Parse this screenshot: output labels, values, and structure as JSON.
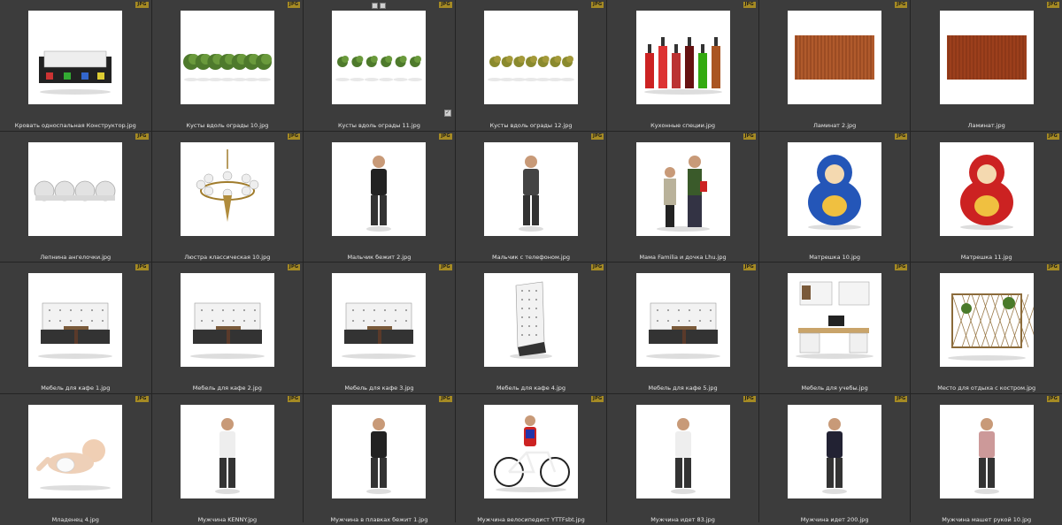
{
  "items": [
    {
      "caption": "Кровать односпальная Конструктор.jpg",
      "badge": "JPG",
      "icon": "bed-icon"
    },
    {
      "caption": "Кусты вдоль ограды 10.jpg",
      "badge": "JPG",
      "icon": "bushes-icon"
    },
    {
      "caption": "Кусты вдоль ограды 11.jpg",
      "badge": "JPG",
      "icon": "bushes-icon"
    },
    {
      "caption": "Кусты вдоль ограды 12.jpg",
      "badge": "JPG",
      "icon": "bushes-icon"
    },
    {
      "caption": "Кухонные специи.jpg",
      "badge": "JPG",
      "icon": "bottles-icon"
    },
    {
      "caption": "Ламинат 2.jpg",
      "badge": "JPG",
      "icon": "laminate-icon"
    },
    {
      "caption": "Ламинат.jpg",
      "badge": "JPG",
      "icon": "laminate-icon"
    },
    {
      "caption": "Лепнина ангелочки.jpg",
      "badge": "JPG",
      "icon": "stucco-icon"
    },
    {
      "caption": "Люстра классическая 10.jpg",
      "badge": "JPG",
      "icon": "chandelier-icon"
    },
    {
      "caption": "Мальчик бежит 2.jpg",
      "badge": "JPG",
      "icon": "person-icon"
    },
    {
      "caption": "Мальчик с телефоном.jpg",
      "badge": "JPG",
      "icon": "person-icon"
    },
    {
      "caption": "Мама Familia и дочка Lhu.jpg",
      "badge": "JPG",
      "icon": "people-icon"
    },
    {
      "caption": "Матрешка 10.jpg",
      "badge": "JPG",
      "icon": "matryoshka-icon"
    },
    {
      "caption": "Матрешка 11.jpg",
      "badge": "JPG",
      "icon": "matryoshka-icon"
    },
    {
      "caption": "Мебель для кафе 1.jpg",
      "badge": "JPG",
      "icon": "sofa-icon"
    },
    {
      "caption": "Мебель для кафе 2.jpg",
      "badge": "JPG",
      "icon": "sofa-icon"
    },
    {
      "caption": "Мебель для кафе 3.jpg",
      "badge": "JPG",
      "icon": "sofa-icon"
    },
    {
      "caption": "Мебель для кафе 4.jpg",
      "badge": "JPG",
      "icon": "chair-icon"
    },
    {
      "caption": "Мебель для кафе 5.jpg",
      "badge": "JPG",
      "icon": "sofa-icon"
    },
    {
      "caption": "Мебель для учебы.jpg",
      "badge": "JPG",
      "icon": "desk-icon"
    },
    {
      "caption": "Место для отдыха с костром.jpg",
      "badge": "JPG",
      "icon": "pergola-icon"
    },
    {
      "caption": "Младенец 4.jpg",
      "badge": "JPG",
      "icon": "baby-icon"
    },
    {
      "caption": "Мужчина KENNY.jpg",
      "badge": "JPG",
      "icon": "person-icon"
    },
    {
      "caption": "Мужчина в плавках бежит 1.jpg",
      "badge": "JPG",
      "icon": "person-icon"
    },
    {
      "caption": "Мужчина велосипедист YTTFsbt.jpg",
      "badge": "JPG",
      "icon": "cyclist-icon"
    },
    {
      "caption": "Мужчина идет 83.jpg",
      "badge": "JPG",
      "icon": "person-icon"
    },
    {
      "caption": "Мужчина идет 200.jpg",
      "badge": "JPG",
      "icon": "person-icon"
    },
    {
      "caption": "Мужчина машет рукой 10.jpg",
      "badge": "JPG",
      "icon": "person-icon"
    }
  ],
  "colors": {
    "background": "#3c3c3c",
    "separator": "#242424",
    "badge": "#a58a24",
    "caption": "#e8e8e8"
  }
}
